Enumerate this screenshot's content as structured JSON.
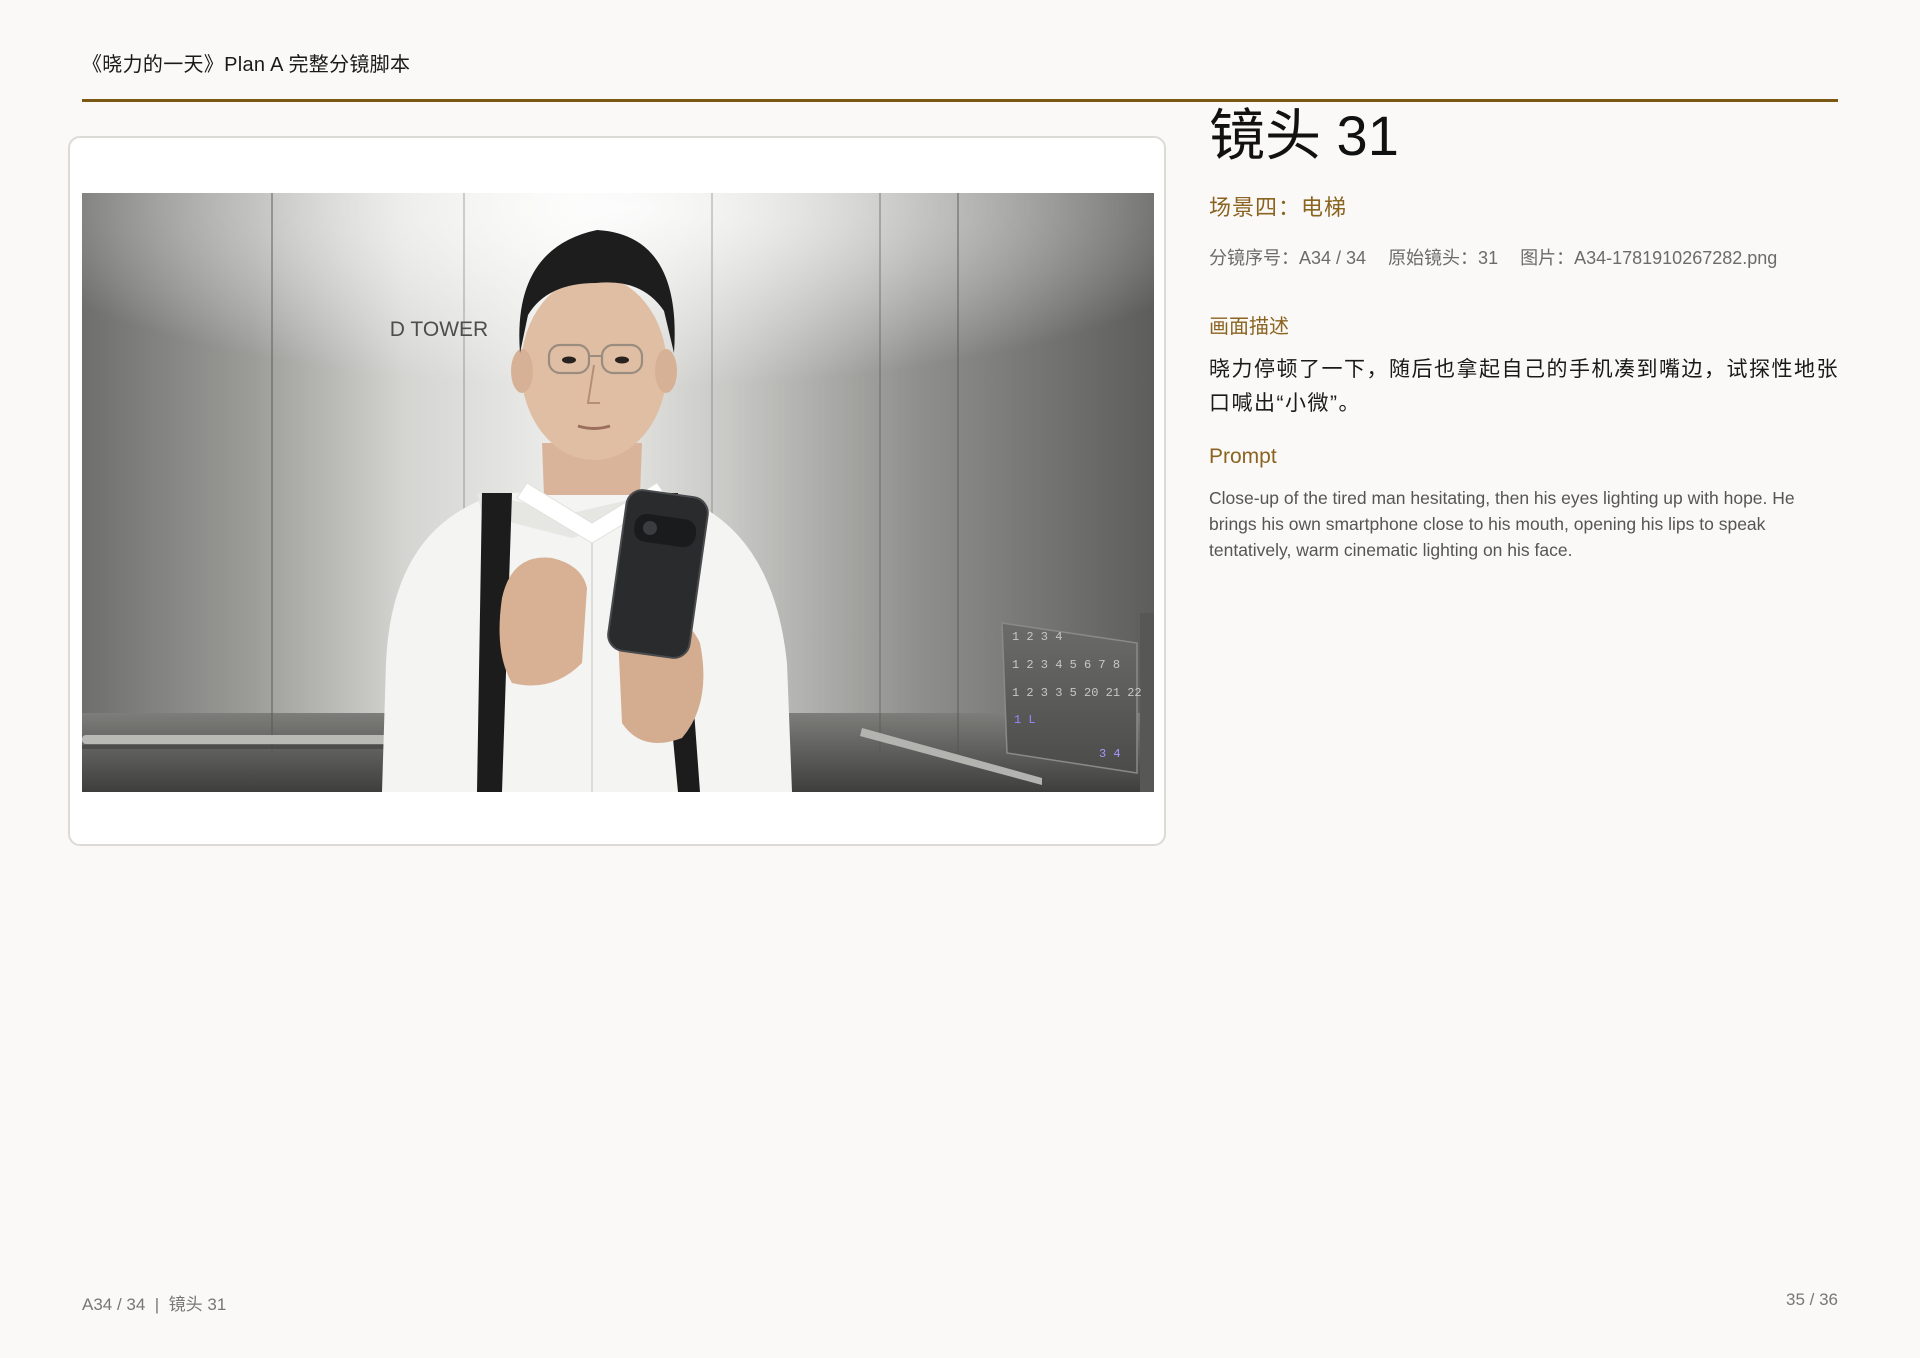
{
  "header": {
    "doc_title": "《晓力的一天》Plan A 完整分镜脚本"
  },
  "shot": {
    "title": "镜头 31",
    "scene": "场景四：电梯",
    "meta": {
      "sequence": "分镜序号：A34 / 34",
      "original": "原始镜头：31",
      "image": "图片：A34-1781910267282.png"
    },
    "description_label": "画面描述",
    "description": "晓力停顿了一下，随后也拿起自己的手机凑到嘴边，试探性地张口喊出“小微”。",
    "prompt_label": "Prompt",
    "prompt": "Close-up of the tired man hesitating, then his eyes lighting up with hope. He brings his own smartphone close to his mouth, opening his lips to speak tentatively, warm cinematic lighting on his face."
  },
  "image": {
    "wall_text": "D TOWER",
    "panel_rows": [
      "1 2 3 4",
      "1 2 3 4 5 6 7 8",
      "1 2 3 3 5 20 21 22"
    ],
    "panel_small": "1 L",
    "panel_button": "3 4"
  },
  "footer": {
    "left": "A34 / 34  |  镜头 31",
    "right": "35 / 36"
  },
  "colors": {
    "accent": "#7a5a12",
    "label": "#8a6420",
    "background": "#faf9f7"
  }
}
